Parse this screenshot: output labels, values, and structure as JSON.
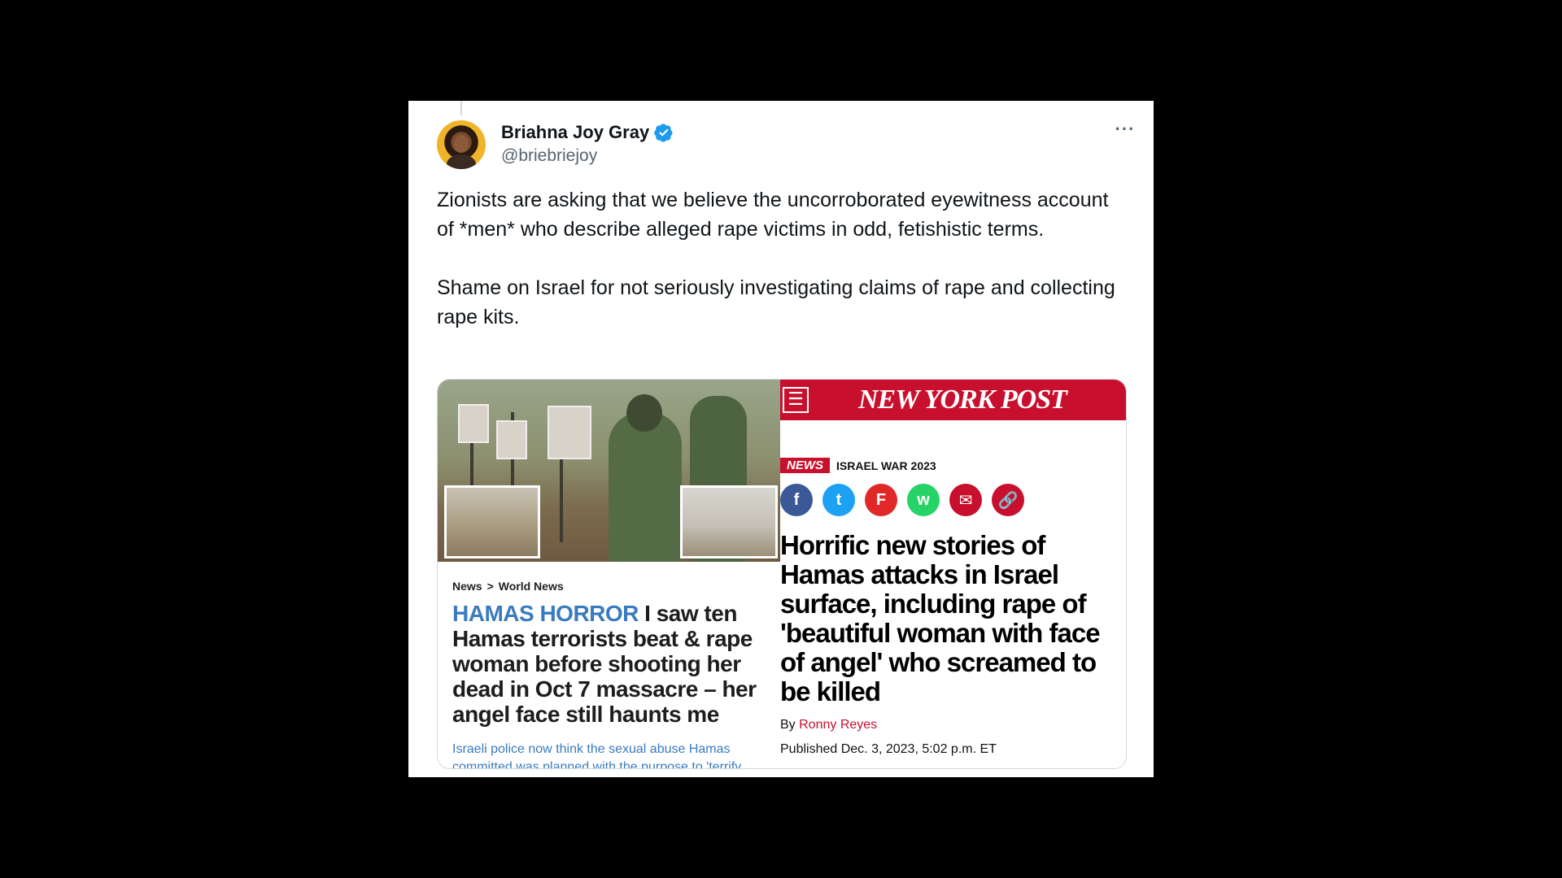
{
  "tweet": {
    "display_name": "Briahna Joy Gray",
    "handle": "@briebriejoy",
    "more_label": "···",
    "paragraphs": [
      "Zionists are asking that we believe the uncorroborated eyewitness account of *men* who describe alleged rape victims in odd, fetishistic terms.",
      "Shame on Israel for not seriously investigating claims of rape and collecting rape kits."
    ]
  },
  "left_article": {
    "breadcrumb_1": "News",
    "breadcrumb_sep": ">",
    "breadcrumb_2": "World News",
    "kicker": "HAMAS HORROR",
    "headline": " I saw ten Hamas terrorists beat & rape woman before shooting her dead in Oct 7 massacre – her angel face still haunts me",
    "subhead": "Israeli police now think the sexual abuse Hamas committed was planned with the purpose to 'terrify"
  },
  "right_article": {
    "menu_icon": "☰",
    "logo": "NEW YORK POST",
    "tag": "NEWS",
    "category": "ISRAEL WAR 2023",
    "share_icons": [
      "f",
      "t",
      "F",
      "w",
      "✉",
      "🔗"
    ],
    "headline": "Horrific new stories of Hamas attacks in Israel surface, including rape of 'beautiful woman with face of angel' who screamed to be killed",
    "by_prefix": "By ",
    "author": "Ronny Reyes",
    "published": "Published Dec. 3, 2023, 5:02 p.m. ET"
  },
  "colors": {
    "verified": "#1d9bf0",
    "nyp_red": "#c8102e",
    "kicker_blue": "#3a7bbf",
    "handle_gray": "#536471"
  }
}
